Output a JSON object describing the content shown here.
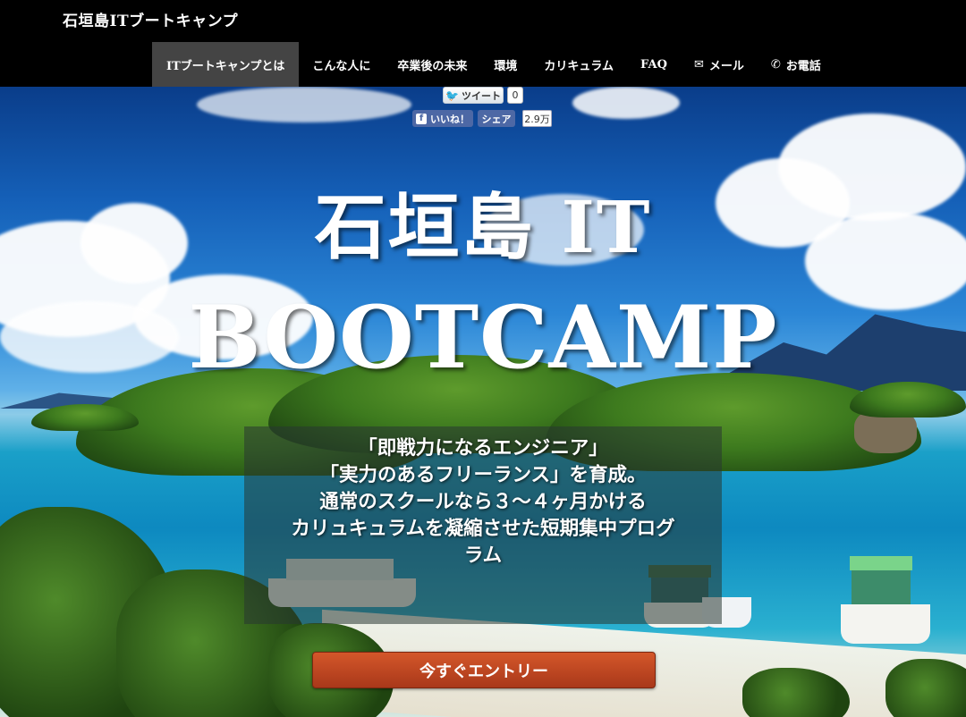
{
  "header": {
    "brand": "石垣島ITブートキャンプ",
    "nav": [
      {
        "label": "ITブートキャンプとは",
        "active": true
      },
      {
        "label": "こんな人に"
      },
      {
        "label": "卒業後の未来"
      },
      {
        "label": "環境"
      },
      {
        "label": "カリキュラム"
      },
      {
        "label": "FAQ"
      },
      {
        "label": "メール",
        "icon": "envelope-icon"
      },
      {
        "label": "お電話",
        "icon": "phone-icon"
      }
    ]
  },
  "social": {
    "tweet_label": "ツイート",
    "tweet_count": "0",
    "like_label": "いいね！",
    "share_label": "シェア",
    "share_count": "2.9万"
  },
  "hero": {
    "title_line1": "石垣島 IT",
    "title_line2": "BOOTCAMP",
    "tagline": [
      "「即戦力になるエンジニア」",
      "「実力のあるフリーランス」を育成。",
      "通常のスクールなら３〜４ヶ月かける",
      "カリュキュラムを凝縮させた短期集中プログ",
      "ラム"
    ],
    "cta_label": "今すぐエントリー"
  },
  "colors": {
    "nav_bg": "#000000",
    "nav_active_bg": "#444444",
    "cta": "#c24a22",
    "facebook": "#4d68a5",
    "twitter": "#2aa3ef"
  }
}
